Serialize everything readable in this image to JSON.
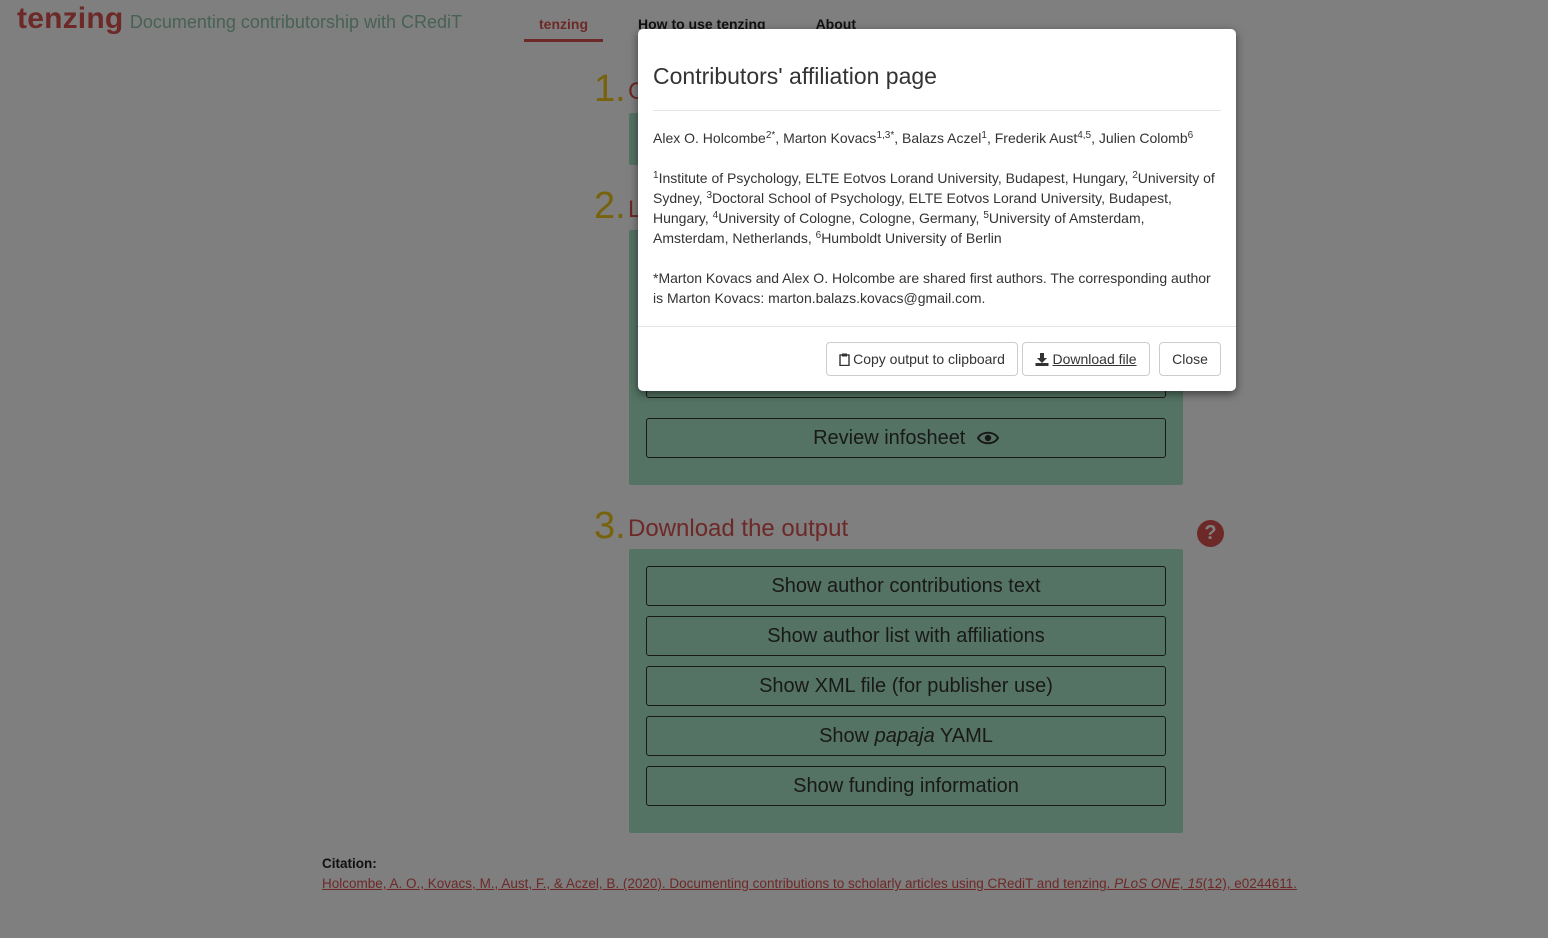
{
  "navbar": {
    "brand_name": "tenzing",
    "brand_tagline": "Documenting contributorship with CRediT",
    "tabs": [
      {
        "label": "tenzing",
        "active": true
      },
      {
        "label": "How to use tenzing",
        "active": false
      },
      {
        "label": "About",
        "active": false
      }
    ]
  },
  "steps": {
    "step1": {
      "number": "1.",
      "title_visible": "C"
    },
    "step2": {
      "number": "2.",
      "title_visible": "L"
    },
    "step3": {
      "number": "3.",
      "title": "Download the output"
    }
  },
  "step2_buttons": {
    "review_infosheet": "Review infosheet"
  },
  "step3_buttons": {
    "contributions_text": "Show author contributions text",
    "author_list": "Show author list with affiliations",
    "xml_file": "Show XML file (for publisher use)",
    "papaja_prefix": "Show ",
    "papaja_em": "papaja",
    "papaja_suffix": " YAML",
    "funding": "Show funding information"
  },
  "citation": {
    "label": "Citation:",
    "text_a": "Holcombe, A. O., Kovacs, M., Aust, F., & Aczel, B. (2020). Documenting contributions to scholarly articles using CRediT and tenzing. ",
    "journal": "PLoS ONE, 15",
    "text_b": "(12), e0244611."
  },
  "modal": {
    "title": "Contributors' affiliation page",
    "authors": [
      {
        "name": "Alex O. Holcombe",
        "sup": "2*"
      },
      {
        "name": "Marton Kovacs",
        "sup": "1,3*"
      },
      {
        "name": "Balazs Aczel",
        "sup": "1"
      },
      {
        "name": "Frederik Aust",
        "sup": "4,5"
      },
      {
        "name": "Julien Colomb",
        "sup": "6"
      }
    ],
    "affiliations": [
      {
        "sup": "1",
        "text": "Institute of Psychology, ELTE Eotvos Lorand University, Budapest, Hungary"
      },
      {
        "sup": "2",
        "text": "University of Sydney"
      },
      {
        "sup": "3",
        "text": "Doctoral School of Psychology, ELTE Eotvos Lorand University, Budapest, Hungary"
      },
      {
        "sup": "4",
        "text": "University of Cologne, Cologne, Germany"
      },
      {
        "sup": "5",
        "text": "University of Amsterdam, Amsterdam, Netherlands"
      },
      {
        "sup": "6",
        "text": "Humboldt University of Berlin"
      }
    ],
    "note": "*Marton Kovacs and Alex O. Holcombe are shared first authors. The corresponding author is Marton Kovacs: marton.balazs.kovacs@gmail.com.",
    "buttons": {
      "copy": "Copy output to clipboard",
      "download": "Download file",
      "close": "Close"
    }
  },
  "colors": {
    "brand_red": "#d9534f",
    "brand_green": "#8fc4a9",
    "step_number": "#f0c419",
    "panel_green": "#a8e6c8"
  },
  "icons": [
    "eye-icon",
    "question-circle-icon",
    "clipboard-icon",
    "download-icon"
  ]
}
